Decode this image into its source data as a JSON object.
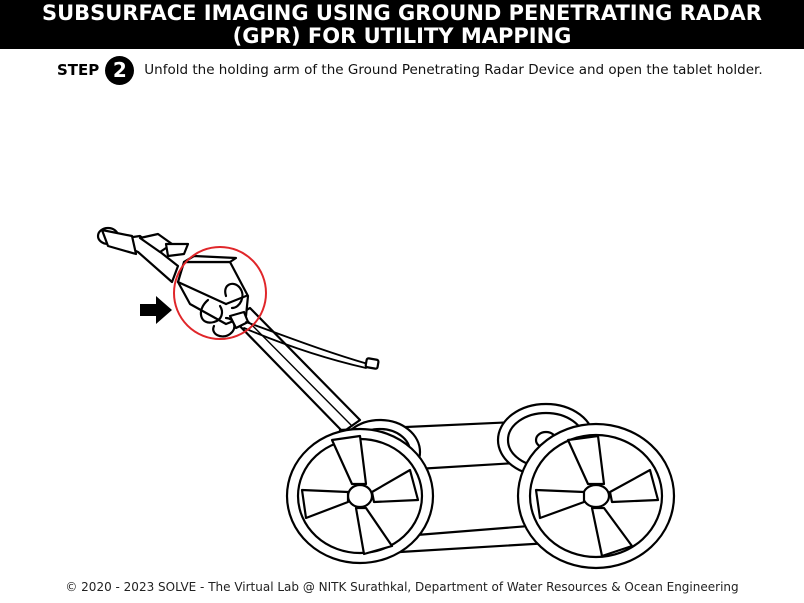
{
  "header": {
    "title_line1": "SUBSURFACE IMAGING USING GROUND PENETRATING RADAR",
    "title_line2": "(GPR) FOR UTILITY MAPPING"
  },
  "step": {
    "label": "STEP",
    "number": "2",
    "instruction": "Unfold the holding arm of the Ground Penetrating Radar Device and open the tablet holder."
  },
  "illustration": {
    "subject": "gpr-cart",
    "highlight_color": "#e0262a",
    "pointer_icon": "arrow-right-icon"
  },
  "footer": {
    "copyright": "© 2020 - 2023 SOLVE - The Virtual Lab @ NITK Surathkal, Department of Water Resources & Ocean Engineering"
  }
}
